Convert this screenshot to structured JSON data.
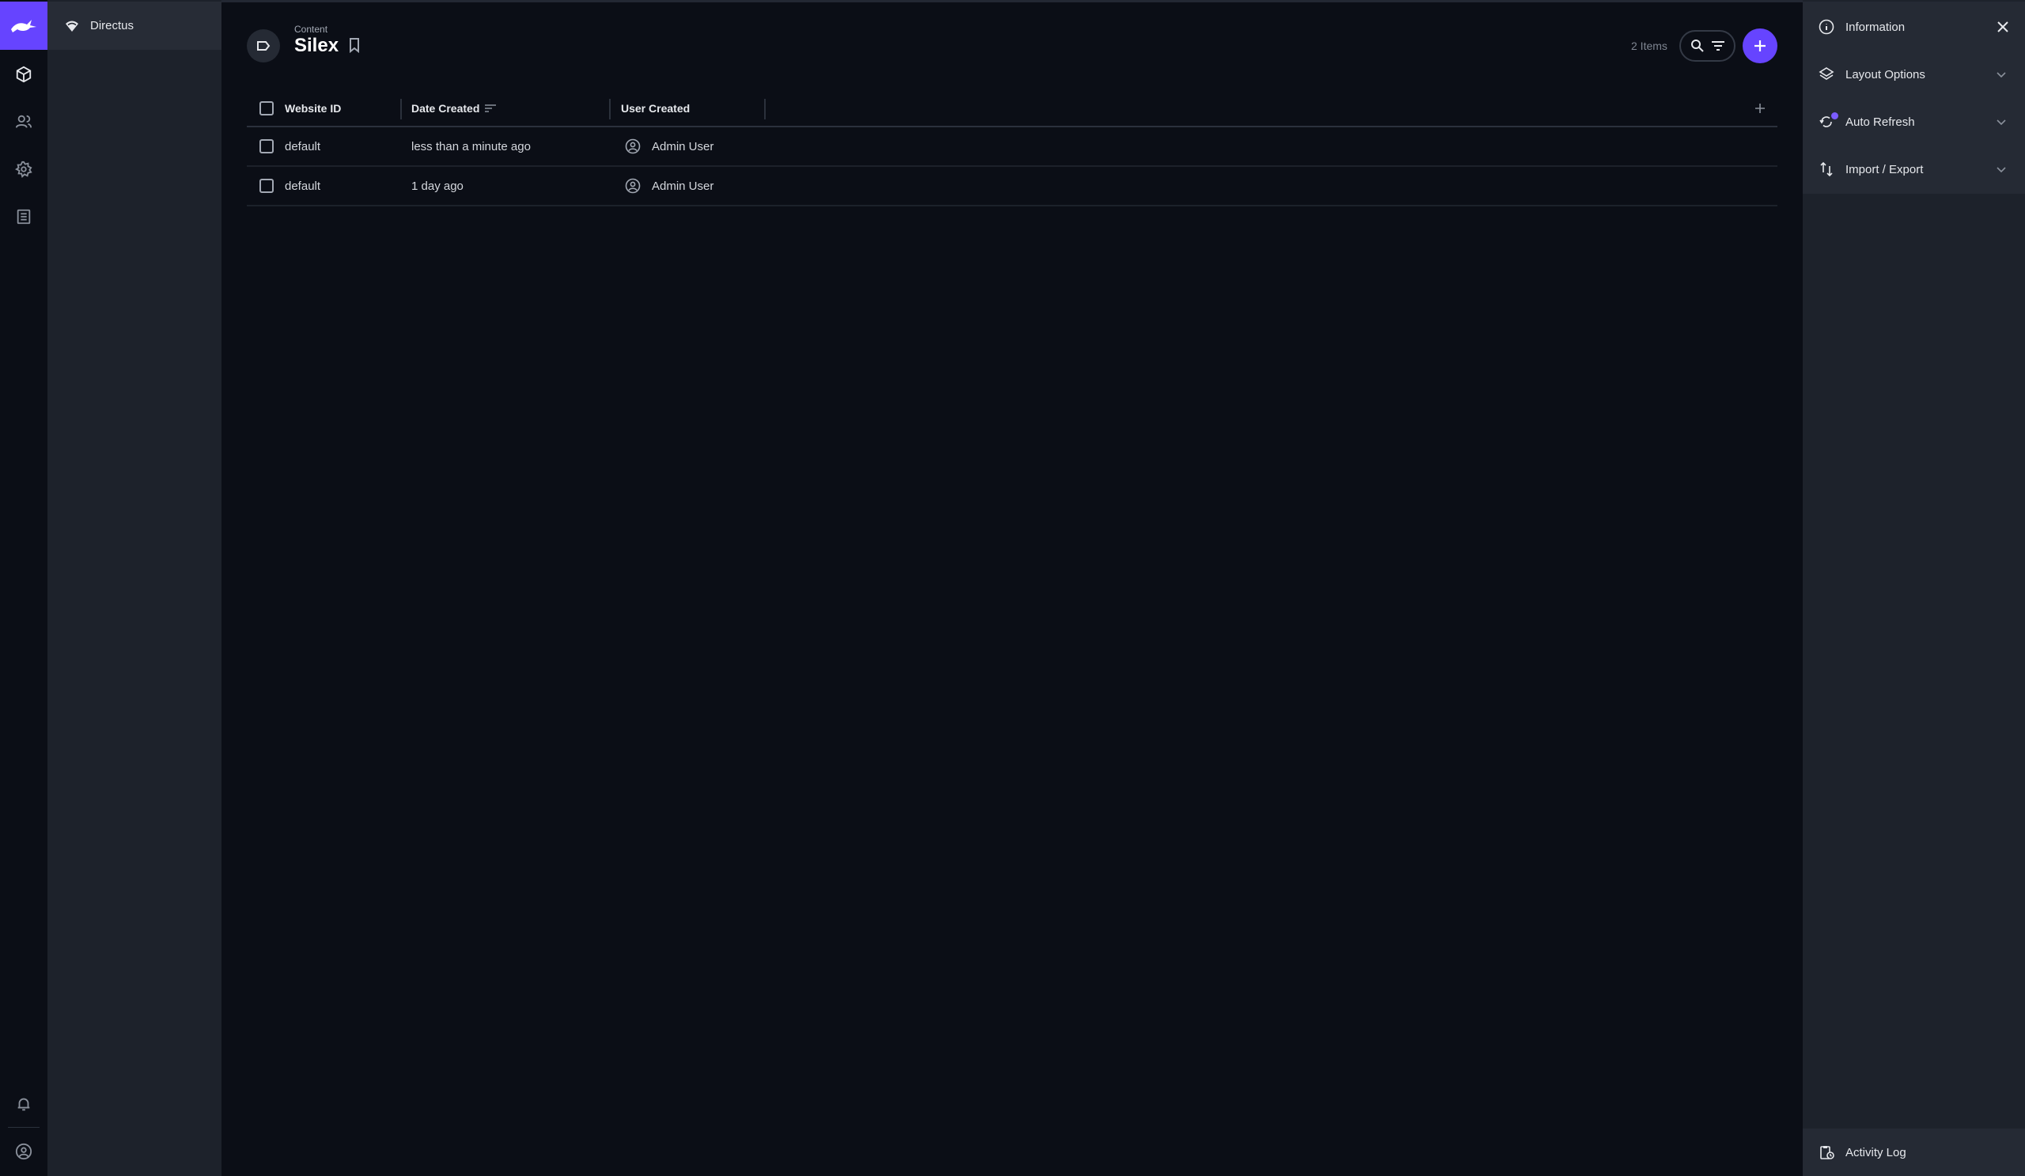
{
  "project": {
    "name": "Directus"
  },
  "module_bar": {
    "items": [
      "content-icon",
      "users-icon",
      "settings-icon",
      "docs-icon"
    ],
    "bottom": [
      "notifications-icon",
      "user-profile-icon"
    ],
    "accent": "#6644ff"
  },
  "header": {
    "breadcrumb": "Content",
    "title": "Silex",
    "item_count": "2 Items"
  },
  "table": {
    "columns": [
      "Website ID",
      "Date Created",
      "User Created"
    ],
    "rows": [
      {
        "website_id": "default",
        "date_created": "less than a minute ago",
        "user_created": "Admin User"
      },
      {
        "website_id": "default",
        "date_created": "1 day ago",
        "user_created": "Admin User"
      }
    ]
  },
  "sidebar": {
    "information": "Information",
    "layout_options": "Layout Options",
    "auto_refresh": "Auto Refresh",
    "import_export": "Import / Export",
    "activity_log": "Activity Log"
  }
}
